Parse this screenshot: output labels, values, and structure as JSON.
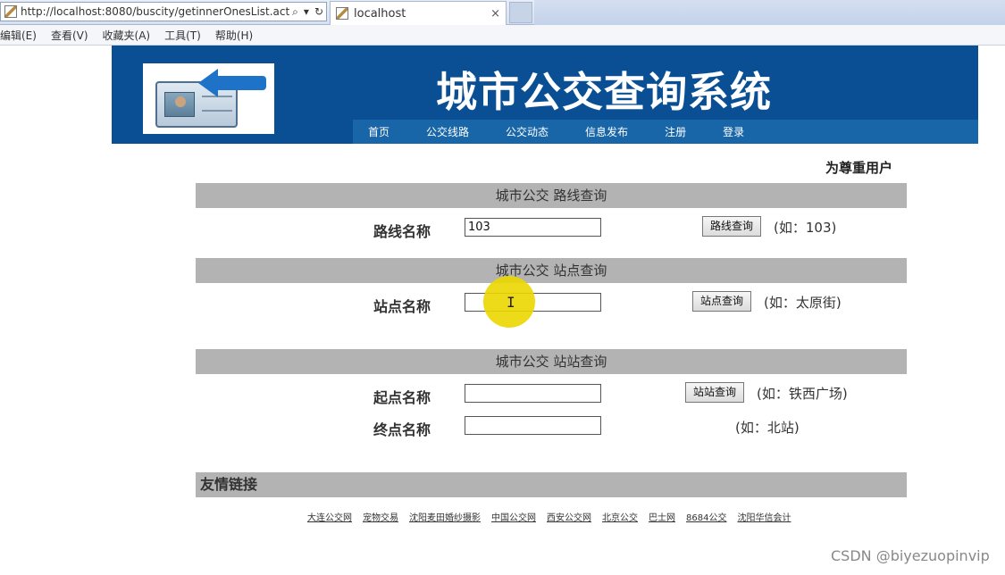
{
  "browser": {
    "url": "http://localhost:8080/buscity/getinnerOnesList.act",
    "tab_title": "localhost",
    "tab_close": "×",
    "search_glyph": "⌕",
    "dropdown_glyph": "▾",
    "refresh_glyph": "↻"
  },
  "menu": [
    "编辑(E)",
    "查看(V)",
    "收藏夹(A)",
    "工具(T)",
    "帮助(H)"
  ],
  "site": {
    "title": "城市公交查询系统",
    "nav": [
      "首页",
      "公交线路",
      "公交动态",
      "信息发布",
      "注册",
      "登录"
    ]
  },
  "user_greeting": "为尊重用户",
  "route_query": {
    "header": "城市公交 路线查询",
    "label": "路线名称",
    "value": "103",
    "button": "路线查询",
    "hint": "(如：103)"
  },
  "station_query": {
    "header": "城市公交 站点查询",
    "label": "站点名称",
    "value": "",
    "button": "站点查询",
    "hint": "(如：太原街)"
  },
  "transfer_query": {
    "header": "城市公交 站站查询",
    "start_label": "起点名称",
    "start_value": "",
    "end_label": "终点名称",
    "end_value": "",
    "button": "站站查询",
    "start_hint": "(如：铁西广场)",
    "end_hint": "(如：北站)"
  },
  "friend_links": {
    "header": "友情链接",
    "items": [
      "大连公交网",
      "宠物交易",
      "沈阳麦田婚纱摄影",
      "中国公交网",
      "西安公交网",
      "北京公交",
      "巴士网",
      "8684公交",
      "沈阳华信会计"
    ]
  },
  "watermark": "CSDN @biyezuopinvip"
}
